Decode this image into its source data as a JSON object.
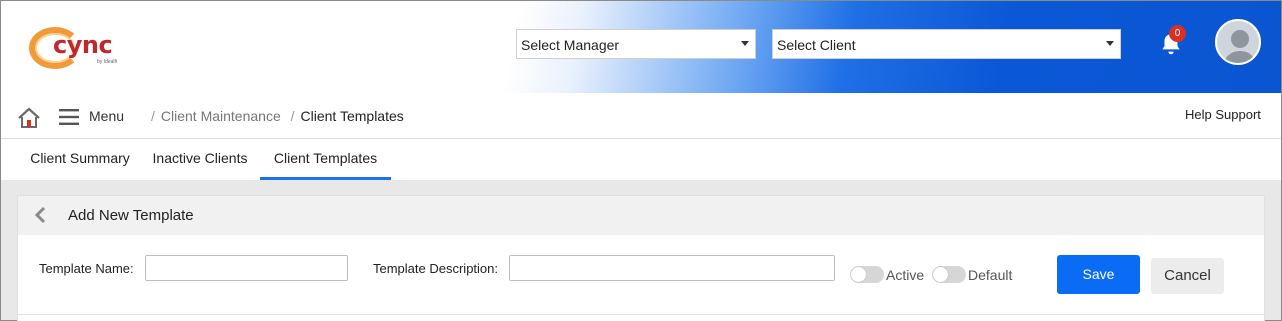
{
  "header": {
    "logo_text": "cync",
    "logo_sub": "by Idealfi",
    "manager_select": {
      "value": "Select Manager"
    },
    "client_select": {
      "value": "Select Client"
    },
    "notification_count": "0"
  },
  "nav": {
    "menu_label": "Menu",
    "breadcrumb": {
      "parent": "Client Maintenance",
      "current": "Client Templates"
    },
    "help_support": "Help Support"
  },
  "tabs": [
    {
      "label": "Client Summary",
      "active": false
    },
    {
      "label": "Inactive Clients",
      "active": false
    },
    {
      "label": "Client Templates",
      "active": true
    }
  ],
  "panel": {
    "title": "Add New Template",
    "template_name_label": "Template Name:",
    "template_name_value": "",
    "template_description_label": "Template Description:",
    "template_description_value": "",
    "active_label": "Active",
    "active_on": false,
    "default_label": "Default",
    "default_on": false,
    "save_label": "Save",
    "cancel_label": "Cancel"
  },
  "colors": {
    "accent": "#0a6cf5",
    "tab_underline": "#1a73e8",
    "badge": "#d93025",
    "logo_red": "#c0282d",
    "logo_orange": "#f29a3a"
  }
}
